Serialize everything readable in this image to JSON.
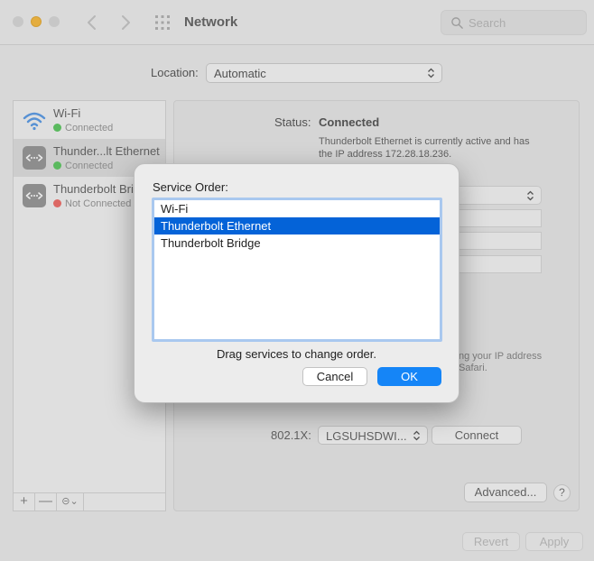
{
  "window": {
    "title": "Network",
    "search_placeholder": "Search"
  },
  "location": {
    "label": "Location:",
    "value": "Automatic"
  },
  "services": [
    {
      "name": "Wi-Fi",
      "status": "Connected",
      "status_color": "green",
      "icon": "wifi-icon"
    },
    {
      "name": "Thunder...lt Ethernet",
      "status": "Connected",
      "status_color": "green",
      "icon": "ethernet-icon"
    },
    {
      "name": "Thunderbolt Bri",
      "status": "Not Connected",
      "status_color": "red",
      "icon": "ethernet-icon"
    }
  ],
  "detail": {
    "status_label": "Status:",
    "status_value": "Connected",
    "status_desc": "Thunderbolt Ethernet is currently active and has the IP address 172.28.18.236.",
    "ip_hint_line1": "ng your IP address",
    "ip_hint_line2": "Safari.",
    "x8021_label": "802.1X:",
    "x8021_value": "LGSUHSDWI...",
    "connect_label": "Connect",
    "advanced_label": "Advanced...",
    "help_label": "?",
    "revert_label": "Revert",
    "apply_label": "Apply"
  },
  "sidebar_tools": {
    "add": "+",
    "remove": "—",
    "action": "⊝⌄"
  },
  "sheet": {
    "title": "Service Order:",
    "items": [
      "Wi-Fi",
      "Thunderbolt Ethernet",
      "Thunderbolt Bridge"
    ],
    "selected_index": 1,
    "hint": "Drag services to change order.",
    "cancel_label": "Cancel",
    "ok_label": "OK"
  },
  "colors": {
    "accent": "#0463d8",
    "ok_button": "#1585f7",
    "connected": "#4ec152",
    "not_connected": "#ec5f59"
  }
}
